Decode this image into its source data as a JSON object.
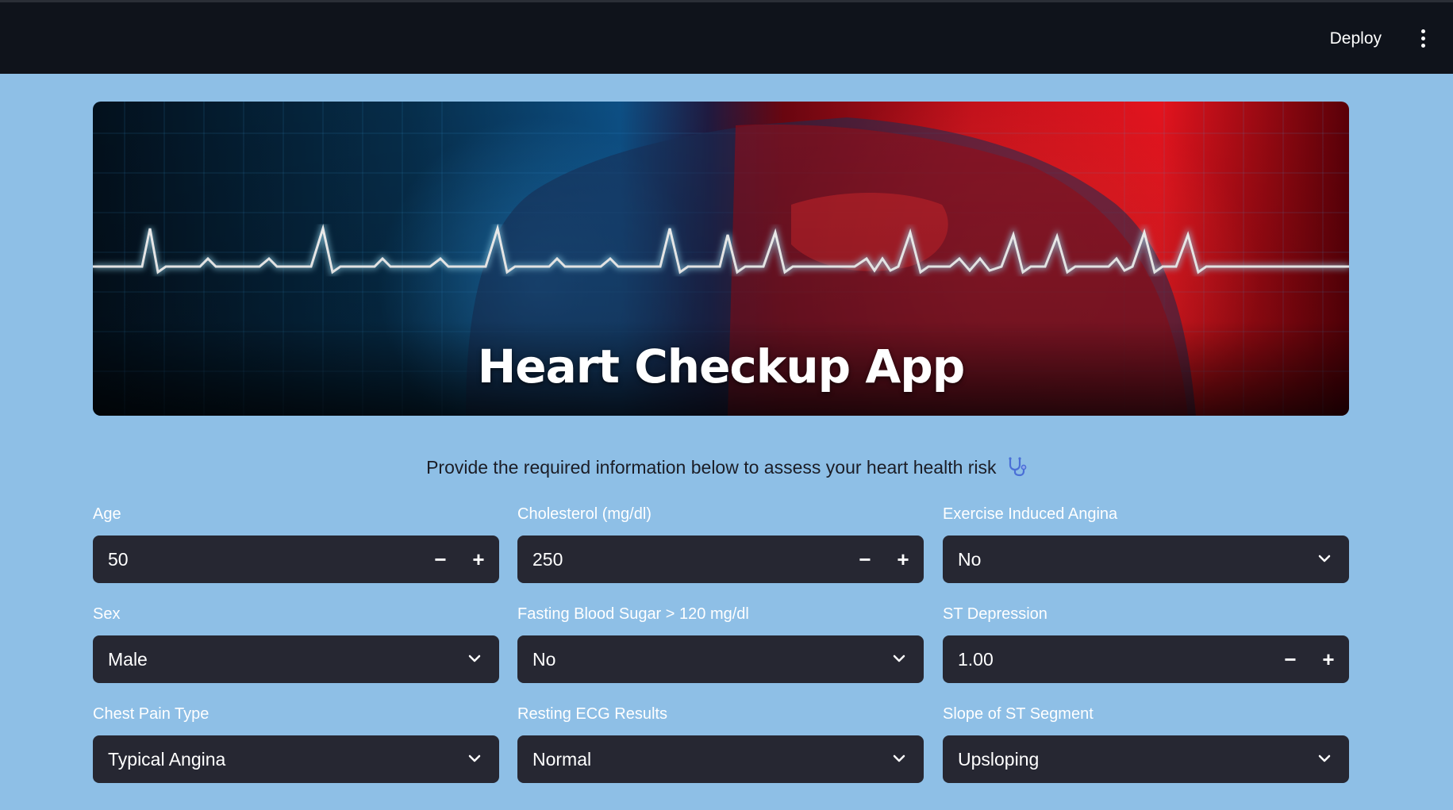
{
  "header": {
    "deploy_label": "Deploy",
    "menu_icon": "kebab-menu-icon"
  },
  "banner": {
    "title": "Heart Checkup App"
  },
  "intro": {
    "text": "Provide the required information below to assess your heart health risk",
    "icon": "stethoscope-icon"
  },
  "fields": {
    "age": {
      "label": "Age",
      "value": "50"
    },
    "cholesterol": {
      "label": "Cholesterol (mg/dl)",
      "value": "250"
    },
    "exercise_angina": {
      "label": "Exercise Induced Angina",
      "value": "No"
    },
    "sex": {
      "label": "Sex",
      "value": "Male"
    },
    "fasting_blood_sugar": {
      "label": "Fasting Blood Sugar > 120 mg/dl",
      "value": "No"
    },
    "st_depression": {
      "label": "ST Depression",
      "value": "1.00"
    },
    "chest_pain": {
      "label": "Chest Pain Type",
      "value": "Typical Angina"
    },
    "resting_ecg": {
      "label": "Resting ECG Results",
      "value": "Normal"
    },
    "st_slope": {
      "label": "Slope of ST Segment",
      "value": "Upsloping"
    }
  },
  "stepper": {
    "minus": "−",
    "plus": "+"
  },
  "colors": {
    "header_bg": "#0f131b",
    "page_bg": "#8ebfe6",
    "control_bg": "#262732"
  }
}
